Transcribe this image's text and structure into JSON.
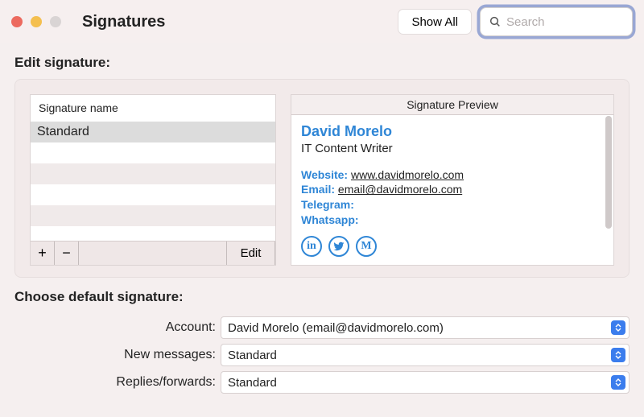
{
  "window": {
    "title": "Signatures"
  },
  "toolbar": {
    "show_all_label": "Show All",
    "search_placeholder": "Search",
    "search_value": ""
  },
  "edit_section": {
    "heading": "Edit signature:",
    "list_header": "Signature name",
    "signatures": [
      "Standard"
    ],
    "add_label": "+",
    "remove_label": "−",
    "edit_label": "Edit"
  },
  "preview": {
    "header": "Signature Preview",
    "name": "David Morelo",
    "role": "IT Content Writer",
    "fields": {
      "website_label": "Website:",
      "website_value": "www.davidmorelo.com",
      "email_label": "Email:",
      "email_value": "email@davidmorelo.com",
      "telegram_label": "Telegram:",
      "telegram_value": "",
      "whatsapp_label": "Whatsapp:",
      "whatsapp_value": ""
    },
    "icons": [
      "in",
      "twitter",
      "M"
    ]
  },
  "defaults_section": {
    "heading": "Choose default signature:",
    "rows": {
      "account_label": "Account:",
      "account_value": "David Morelo (email@davidmorelo.com)",
      "new_label": "New messages:",
      "new_value": "Standard",
      "replies_label": "Replies/forwards:",
      "replies_value": "Standard"
    }
  }
}
